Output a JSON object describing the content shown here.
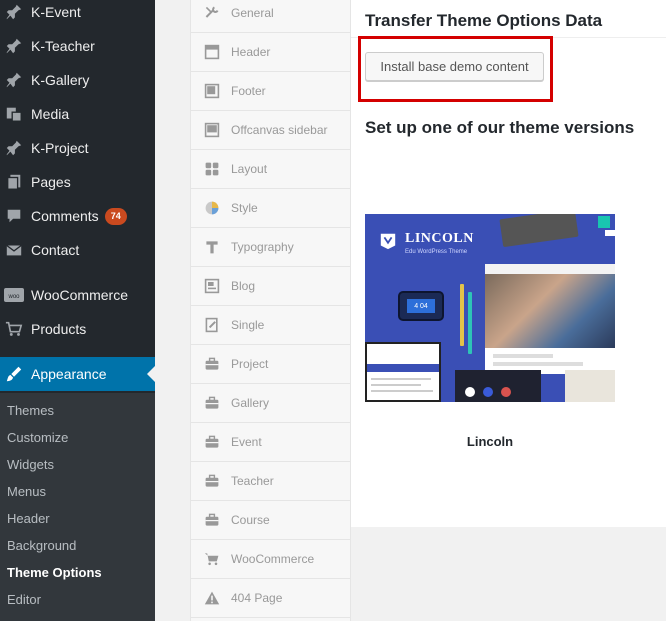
{
  "admin_menu": {
    "items": [
      {
        "label": "K-Event",
        "icon": "pin-icon"
      },
      {
        "label": "K-Teacher",
        "icon": "pin-icon"
      },
      {
        "label": "K-Gallery",
        "icon": "pin-icon"
      },
      {
        "label": "Media",
        "icon": "media-icon"
      },
      {
        "label": "K-Project",
        "icon": "pin-icon"
      },
      {
        "label": "Pages",
        "icon": "pages-icon"
      },
      {
        "label": "Comments",
        "icon": "comments-icon",
        "badge": "74"
      },
      {
        "label": "Contact",
        "icon": "envelope-icon"
      },
      {
        "label": "WooCommerce",
        "icon": "woocommerce-icon"
      },
      {
        "label": "Products",
        "icon": "cart-icon"
      },
      {
        "label": "Appearance",
        "icon": "brush-icon",
        "current": true
      }
    ],
    "submenu": [
      {
        "label": "Themes"
      },
      {
        "label": "Customize"
      },
      {
        "label": "Widgets"
      },
      {
        "label": "Menus"
      },
      {
        "label": "Header"
      },
      {
        "label": "Background"
      },
      {
        "label": "Theme Options",
        "current": true
      },
      {
        "label": "Editor"
      }
    ],
    "colors": {
      "background": "#23282d",
      "submenu_bg": "#32373c",
      "current": "#0073aa",
      "badge": "#ca4a1f"
    }
  },
  "option_tabs": [
    {
      "label": "General",
      "icon": "wrench-icon"
    },
    {
      "label": "Header",
      "icon": "header-layout-icon"
    },
    {
      "label": "Footer",
      "icon": "footer-layout-icon"
    },
    {
      "label": "Offcanvas sidebar",
      "icon": "sidebar-layout-icon"
    },
    {
      "label": "Layout",
      "icon": "grid-icon"
    },
    {
      "label": "Style",
      "icon": "palette-icon"
    },
    {
      "label": "Typography",
      "icon": "text-icon"
    },
    {
      "label": "Blog",
      "icon": "blog-icon"
    },
    {
      "label": "Single",
      "icon": "edit-page-icon"
    },
    {
      "label": "Project",
      "icon": "briefcase-icon"
    },
    {
      "label": "Gallery",
      "icon": "briefcase-icon"
    },
    {
      "label": "Event",
      "icon": "briefcase-icon"
    },
    {
      "label": "Teacher",
      "icon": "briefcase-icon"
    },
    {
      "label": "Course",
      "icon": "briefcase-icon"
    },
    {
      "label": "WooCommerce",
      "icon": "cart-icon"
    },
    {
      "label": "404 Page",
      "icon": "warning-icon"
    }
  ],
  "main": {
    "transfer_title": "Transfer Theme Options Data",
    "install_button": "Install base demo content",
    "versions_title": "Set up one of our theme versions",
    "highlight_color": "#d40000",
    "theme": {
      "name": "Lincoln",
      "preview": {
        "brand": "LINCOLN",
        "tagline": "Edu WordPress Theme",
        "phone_text": "4 04"
      }
    }
  }
}
